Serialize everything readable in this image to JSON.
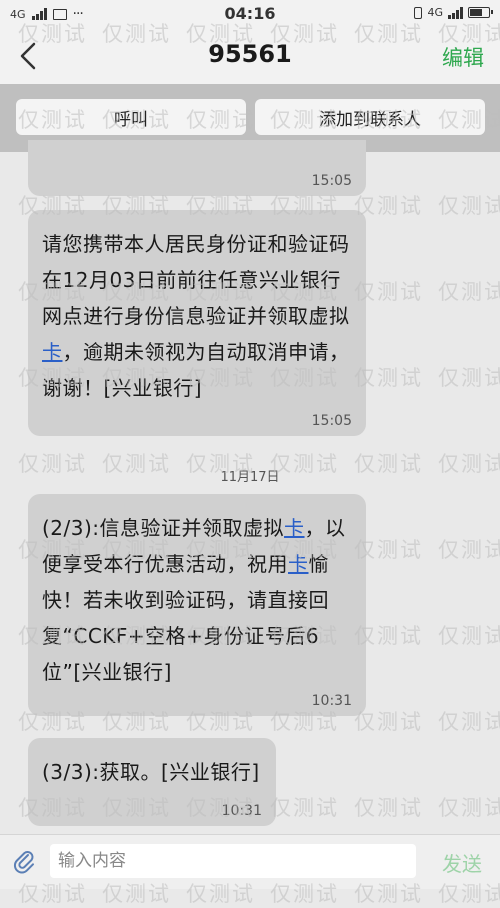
{
  "status_bar": {
    "network": "4G",
    "time": "04:16",
    "network_right": "4G",
    "icons": [
      "signal-icon",
      "image-icon",
      "more-dots-icon",
      "vibrate-icon",
      "battery-icon"
    ]
  },
  "header": {
    "title": "95561",
    "edit_label": "编辑",
    "edit_color": "#2fa84f"
  },
  "actions": {
    "call_label": "呼叫",
    "add_contact_label": "添加到联系人"
  },
  "messages": [
    {
      "time": "15:05"
    },
    {
      "text_before": "请您携带本人居民身份证和验证码在12月03日前前往任意兴业银行网点进行身份信息验证并领取虚拟",
      "link": "卡",
      "text_after": "，逾期未领视为自动取消申请，谢谢！[兴业银行]",
      "time": "15:05"
    },
    {
      "text_before": "(2/3):信息验证并领取虚拟",
      "link": "卡",
      "text_middle": "，以便享受本行优惠活动，祝用",
      "link2": "卡",
      "text_after": "愉快！若未收到验证码，请直接回复“CCKF+空格+身份证号后6位”[兴业银行]",
      "time": "10:31"
    },
    {
      "text": "(3/3):获取。[兴业银行]",
      "time": "10:31"
    }
  ],
  "date_separator": "11月17日",
  "input": {
    "placeholder": "输入内容",
    "send_label": "发送"
  },
  "watermark_text": "仅测试"
}
